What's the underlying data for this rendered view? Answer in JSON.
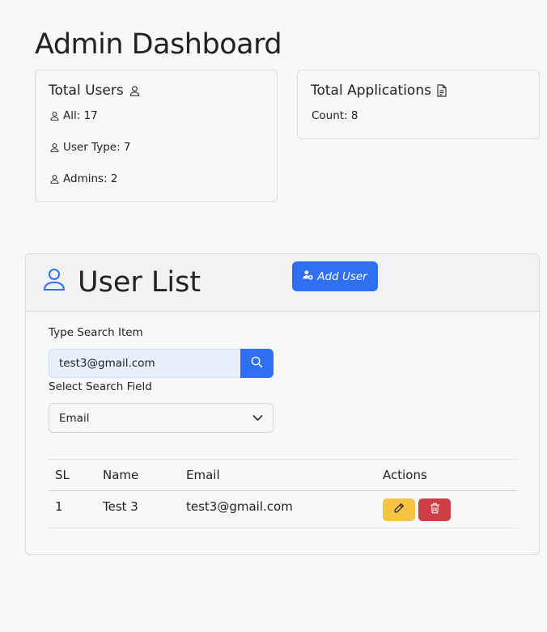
{
  "page": {
    "title": "Admin Dashboard"
  },
  "cards": {
    "users": {
      "title": "Total Users",
      "icon": "user-icon",
      "stats": [
        {
          "label": "All: 17",
          "icon": "user-icon"
        },
        {
          "label": "User Type: 7",
          "icon": "user-icon"
        },
        {
          "label": "Admins: 2",
          "icon": "user-icon"
        }
      ]
    },
    "applications": {
      "title": "Total Applications",
      "icon": "file-text-icon",
      "count_label": "Count: 8"
    }
  },
  "user_list": {
    "title": "User List",
    "title_icon": "user-icon",
    "add_button": {
      "label": "Add User",
      "icon": "user-plus-icon"
    },
    "search": {
      "label": "Type Search Item",
      "value": "test3@gmail.com",
      "button_icon": "search-icon"
    },
    "field_select": {
      "label": "Select Search Field",
      "selected": "Email",
      "icon": "chevron-down-icon"
    },
    "table": {
      "columns": [
        "SL",
        "Name",
        "Email",
        "Actions"
      ],
      "rows": [
        {
          "sl": "1",
          "name": "Test 3",
          "email": "test3@gmail.com"
        }
      ],
      "edit_icon": "pencil-icon",
      "delete_icon": "trash-icon"
    }
  },
  "colors": {
    "primary": "#2f6ff4",
    "warning": "#f6c343",
    "danger": "#cf3e46",
    "background": "#f7f8fa"
  }
}
